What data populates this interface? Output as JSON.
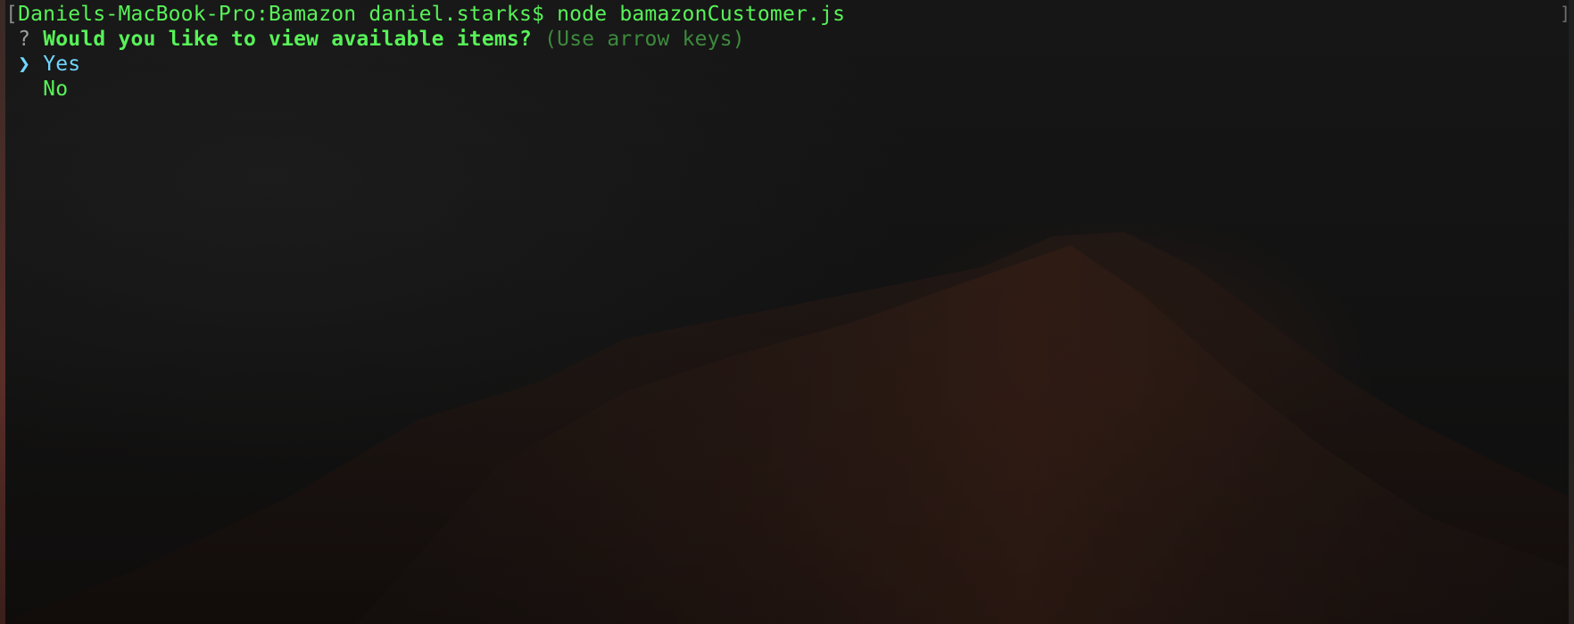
{
  "terminal": {
    "prompt_bracket": "[",
    "prompt": "Daniels-MacBook-Pro:Bamazon daniel.starks$ node bamazonCustomer.js",
    "right_bracket": "]"
  },
  "question": {
    "marker": "?",
    "text": "Would you like to view available items?",
    "hint": "(Use arrow keys)"
  },
  "options": {
    "pointer": "❯",
    "items": [
      "Yes",
      "No"
    ],
    "selected_index": 0
  },
  "colors": {
    "prompt": "#58f258",
    "selected_option": "#6fd7ff",
    "hint": "#3d8a3d",
    "background": "#141414"
  }
}
